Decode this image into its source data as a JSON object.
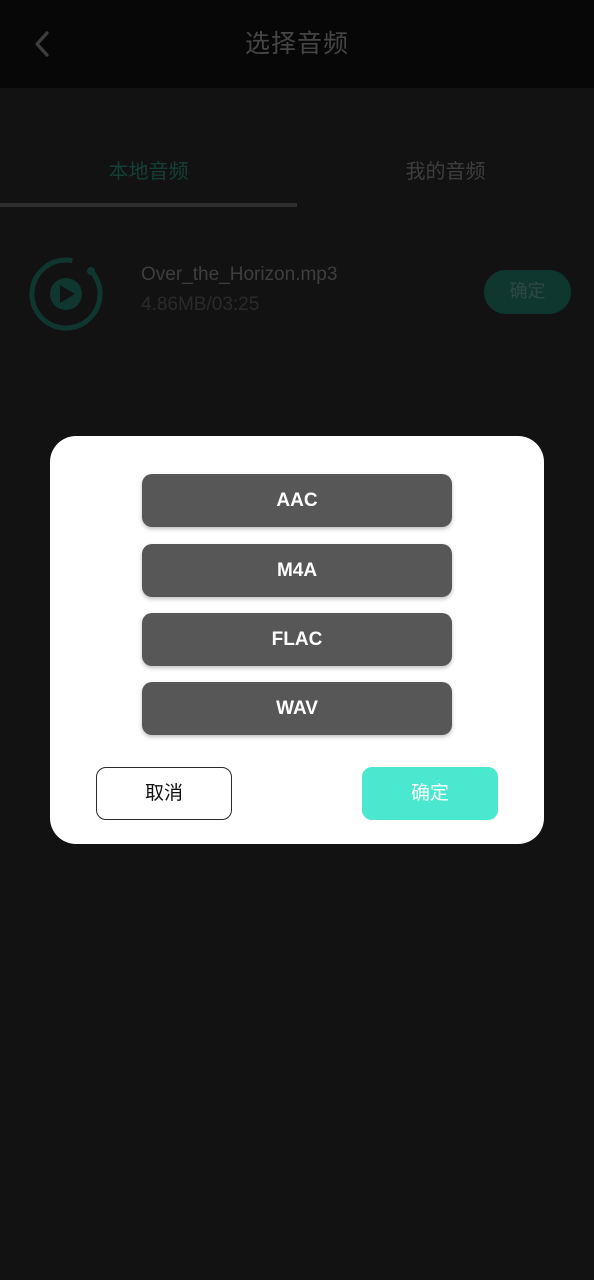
{
  "header": {
    "title": "选择音频",
    "back_icon": "chevron-left-icon"
  },
  "tabs": [
    {
      "label": "本地音频",
      "active": true
    },
    {
      "label": "我的音频",
      "active": false
    }
  ],
  "audio_list": [
    {
      "name": "Over_the_Horizon.mp3",
      "meta": "4.86MB/03:25",
      "confirm_label": "确定",
      "icon": "play-icon"
    }
  ],
  "dialog": {
    "formats": [
      "AAC",
      "M4A",
      "FLAC",
      "WAV"
    ],
    "cancel_label": "取消",
    "confirm_label": "确定"
  },
  "colors": {
    "accent": "#4ae8cf",
    "accent_dim": "#1f6f60",
    "tab_active": "#2a7d6e",
    "format_button": "#575757"
  }
}
